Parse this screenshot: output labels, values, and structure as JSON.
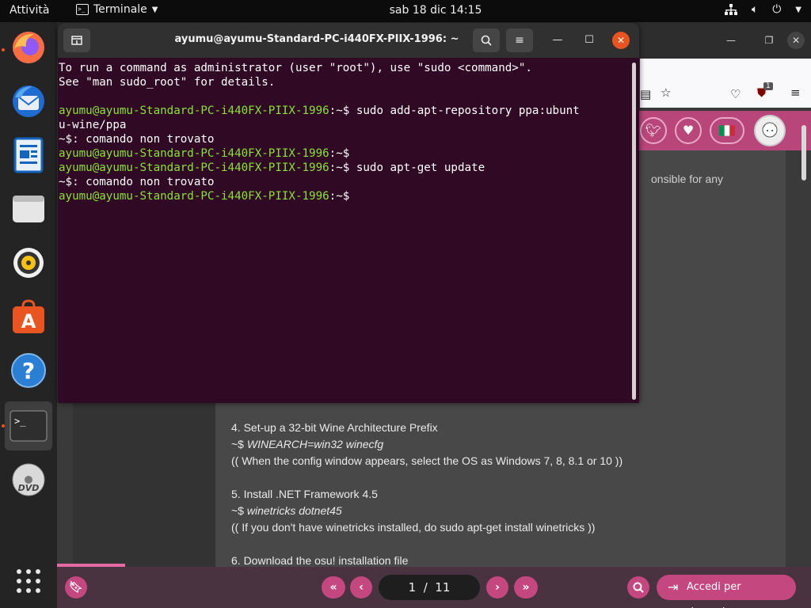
{
  "topbar": {
    "activities": "Attività",
    "app_name": "Terminale",
    "clock": "sab 18 dic  14:15"
  },
  "dock": {
    "items": [
      "firefox-icon",
      "thunderbird-icon",
      "writer-icon",
      "files-icon",
      "rhythmbox-icon",
      "software-icon",
      "help-icon",
      "terminal-icon",
      "dvd-icon",
      "show-apps-icon"
    ]
  },
  "browser": {
    "ublock_badge": "1",
    "article": {
      "partial_text": "onsible for any",
      "lines": [
        {
          "text": "4. Set-up a 32-bit Wine Architecture Prefix",
          "style": "normal"
        },
        {
          "text": "~$ ",
          "cmd": "WINEARCH=win32 winecfg",
          "style": "cmd"
        },
        {
          "text": "(( When the config window appears, select the OS as Windows 7, 8, 8.1 or 10 ))",
          "style": "normal"
        },
        {
          "text": "",
          "style": "normal"
        },
        {
          "text": "5. Install .NET Framework 4.5",
          "style": "normal"
        },
        {
          "text": "~$ ",
          "cmd": "winetricks dotnet45",
          "style": "cmd"
        },
        {
          "text": "(( If you don't have winetricks installed, do sudo apt-get install winetricks ))",
          "style": "normal"
        },
        {
          "text": "",
          "style": "normal"
        },
        {
          "text": "6. Download the osu! installation file",
          "style": "normal"
        }
      ]
    },
    "pager": {
      "current": "1",
      "separator": "/",
      "total": "11"
    },
    "reply_label": "Accedi per rispondere"
  },
  "terminal": {
    "title": "ayumu@ayumu-Standard-PC-i440FX-PIIX-1996: ~",
    "prompt_user": "ayumu@ayumu-Standard-PC-i440FX-PIIX-1996",
    "lines": {
      "l1": "To run a command as administrator (user \"root\"), use \"sudo <command>\".",
      "l2": "See \"man sudo_root\" for details.",
      "cmd1": "~$ sudo add-apt-repository ppa:ubunt",
      "cmd1_wrap": "u-wine/ppa",
      "err1": "~$: comando non trovato",
      "cmd3": "~$ sudo apt-get update",
      "err2": "~$: comando non trovato"
    }
  },
  "colors": {
    "terminal_bg": "#300a24",
    "prompt_green": "#8ae234",
    "accent_pink": "#c5477f",
    "ubuntu_orange": "#e95420"
  }
}
